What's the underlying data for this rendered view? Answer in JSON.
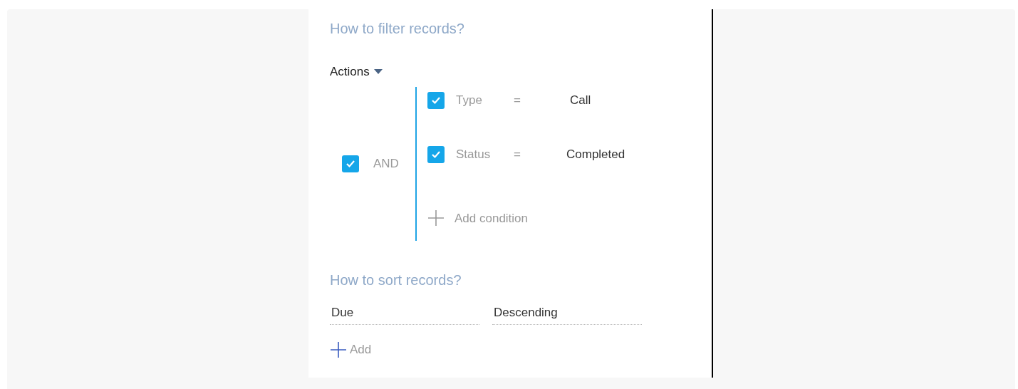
{
  "filter_heading": "How to filter records?",
  "actions_menu": {
    "label": "Actions"
  },
  "group": {
    "checked": true,
    "operator": "AND",
    "conditions": [
      {
        "checked": true,
        "column": "Type",
        "comparison": "=",
        "value": "Call"
      },
      {
        "checked": true,
        "column": "Status",
        "comparison": "=",
        "value": "Completed"
      }
    ],
    "add_label": "Add condition"
  },
  "sort_heading": "How to sort records?",
  "sort": {
    "column": "Due",
    "direction": "Descending"
  },
  "add_sort_label": "Add"
}
